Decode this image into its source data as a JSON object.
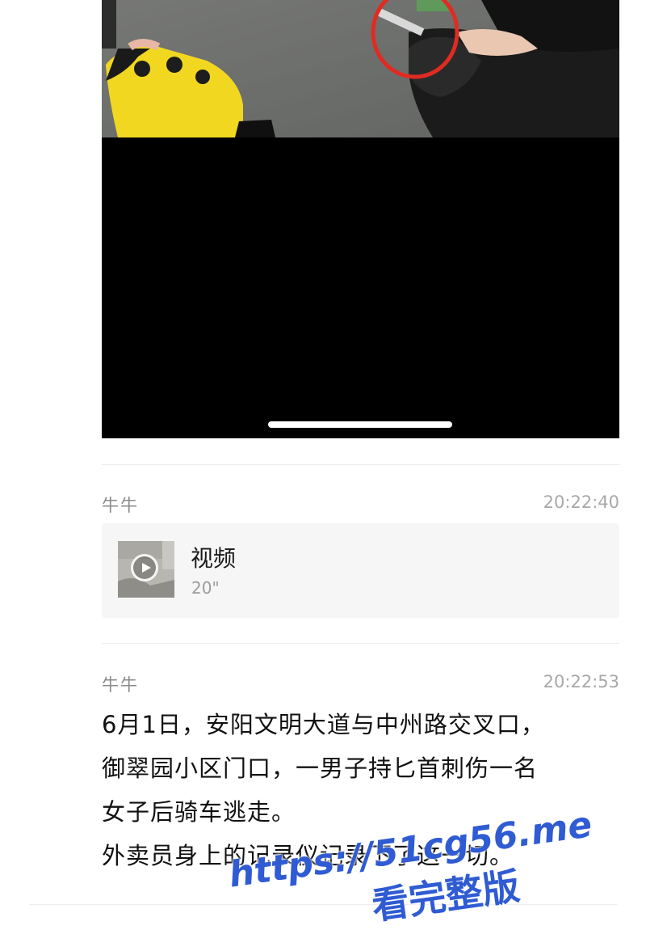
{
  "messages": [
    {
      "sender": "牛牛",
      "time": "20:22:40",
      "video_card": {
        "title": "视频",
        "duration": "20\""
      }
    },
    {
      "sender": "牛牛",
      "time": "20:22:53",
      "text_lines": [
        "6月1日，安阳文明大道与中州路交叉口，",
        "御翠园小区门口，一男子持匕首刺伤一名",
        "女子后骑车逃走。",
        "外卖员身上的记录仪记录下了这一切。"
      ]
    }
  ],
  "watermark": {
    "url": "https://51cg56.me",
    "cta": "看完整版"
  },
  "colors": {
    "watermark": "#2f5bd3",
    "annotation_circle": "#e02b22",
    "glove_yellow": "#f2d720"
  }
}
